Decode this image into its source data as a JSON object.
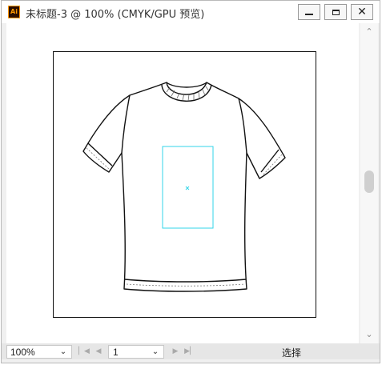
{
  "window": {
    "title": "未标题-3 @ 100% (CMYK/GPU 预览)",
    "app_icon_text": "Ai",
    "minimize_icon": "minimize-icon",
    "maximize_icon": "maximize-icon",
    "close_label": "✕"
  },
  "canvas": {
    "artwork": "t-shirt line drawing",
    "selection_color": "#33d6e8"
  },
  "scrollbar": {
    "up_arrow": "⌃",
    "down_arrow": "⌄"
  },
  "status": {
    "zoom_value": "100%",
    "zoom_arrow": "⌄",
    "first_icon": "▏◀",
    "prev_icon": "◀",
    "page_value": "1",
    "page_arrow": "⌄",
    "next_icon": "▶",
    "last_icon": "▶▏",
    "current_tool": "选择"
  }
}
